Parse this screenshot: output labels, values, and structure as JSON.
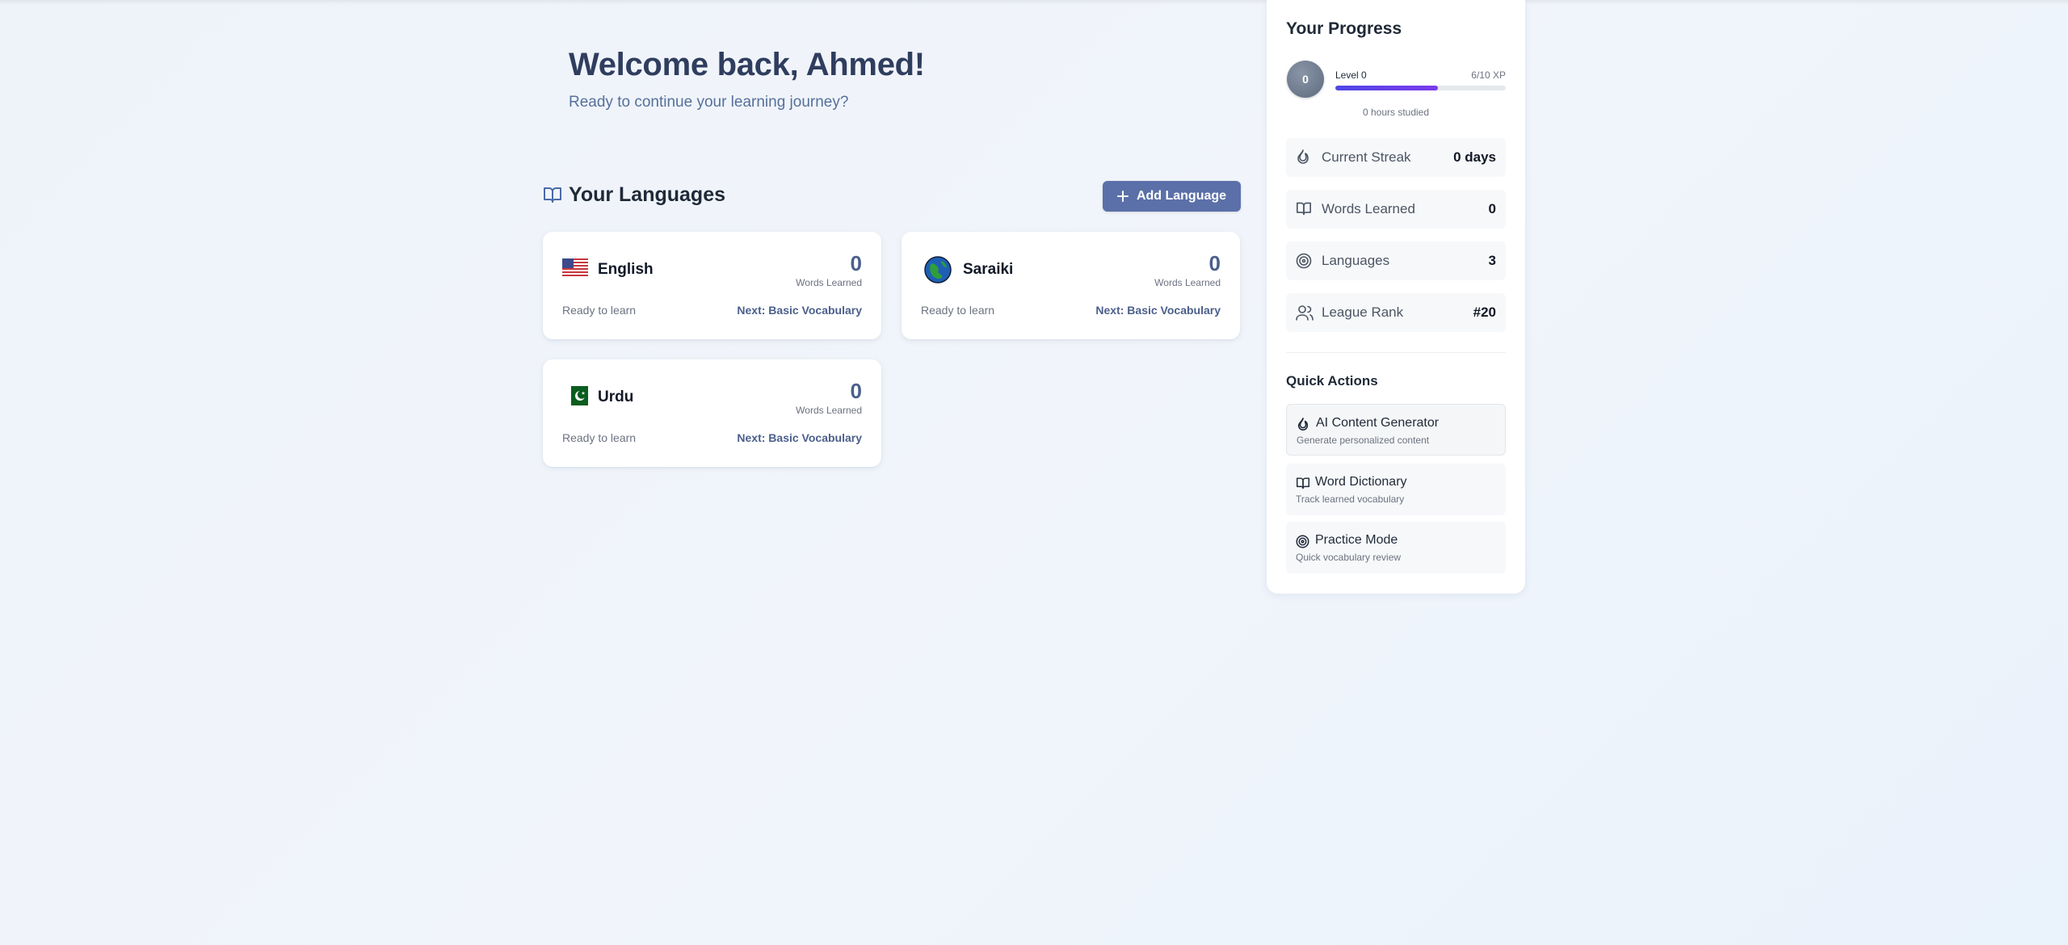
{
  "welcome": {
    "title": "Welcome back, Ahmed!",
    "subtitle": "Ready to continue your learning journey?"
  },
  "languages": {
    "title": "Your Languages",
    "add_button": "Add Language",
    "cards": [
      {
        "name": "English",
        "flag": "us-flag-icon",
        "count": "0",
        "count_label": "Words Learned",
        "status": "Ready to learn",
        "next": "Next: Basic Vocabulary"
      },
      {
        "name": "Saraiki",
        "flag": "globe-icon",
        "count": "0",
        "count_label": "Words Learned",
        "status": "Ready to learn",
        "next": "Next: Basic Vocabulary"
      },
      {
        "name": "Urdu",
        "flag": "pakistan-flag-icon",
        "count": "0",
        "count_label": "Words Learned",
        "status": "Ready to learn",
        "next": "Next: Basic Vocabulary"
      }
    ]
  },
  "progress": {
    "title": "Your Progress",
    "level_badge": "0",
    "level_label": "Level 0",
    "xp_label": "6/10 XP",
    "xp_fraction": 0.6,
    "hours": "0 hours studied",
    "stats": [
      {
        "label": "Current Streak",
        "value": "0 days",
        "icon": "flame-icon"
      },
      {
        "label": "Words Learned",
        "value": "0",
        "icon": "book-icon"
      },
      {
        "label": "Languages",
        "value": "3",
        "icon": "target-icon"
      },
      {
        "label": "League Rank",
        "value": "#20",
        "icon": "users-icon"
      }
    ]
  },
  "quick_actions": {
    "title": "Quick Actions",
    "items": [
      {
        "title": "AI Content Generator",
        "desc": "Generate personalized content",
        "icon": "flame-icon"
      },
      {
        "title": "Word Dictionary",
        "desc": "Track learned vocabulary",
        "icon": "book-icon"
      },
      {
        "title": "Practice Mode",
        "desc": "Quick vocabulary review",
        "icon": "target-icon"
      }
    ]
  },
  "colors": {
    "accent": "#5b70a8",
    "heading": "#2f3d5e",
    "xp_start": "#4f46e5",
    "xp_end": "#7c3aed"
  }
}
